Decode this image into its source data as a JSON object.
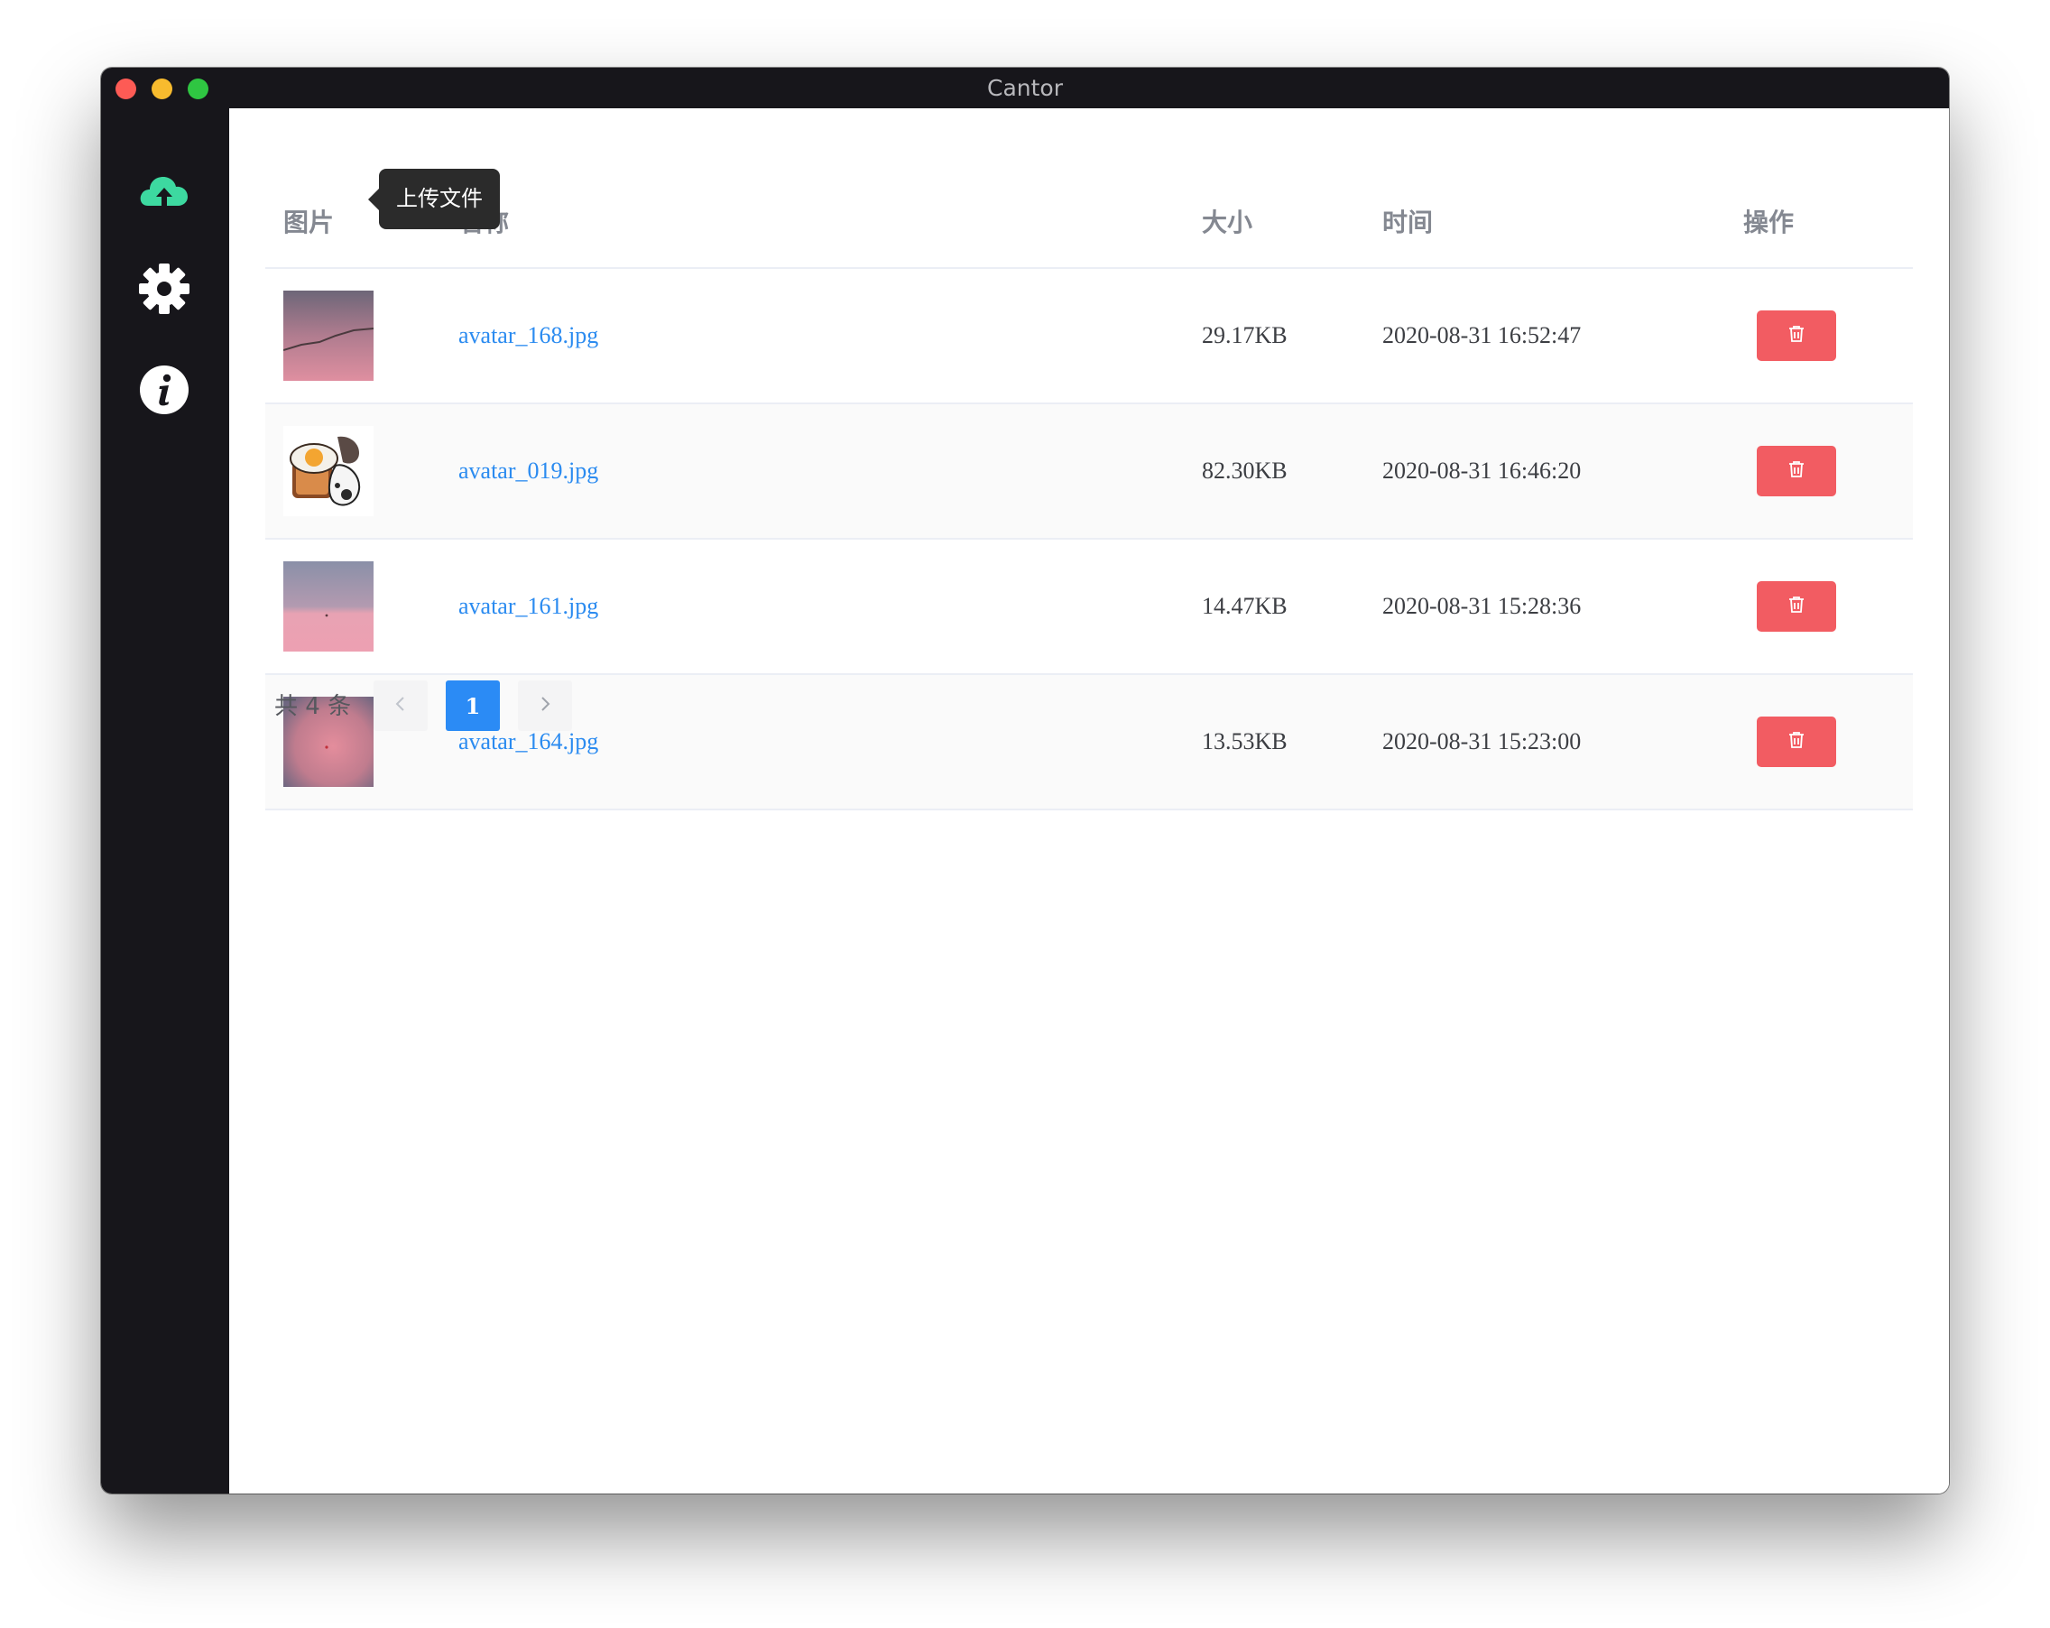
{
  "window": {
    "title": "Cantor"
  },
  "sidebar": {
    "items": [
      {
        "icon": "cloud-upload-icon",
        "active_color": "#3dd9a0"
      },
      {
        "icon": "gear-icon"
      },
      {
        "icon": "info-icon"
      }
    ]
  },
  "tooltip": {
    "text": "上传文件"
  },
  "table": {
    "headers": {
      "image": "图片",
      "name": "名称",
      "size": "大小",
      "time": "时间",
      "actions": "操作"
    },
    "rows": [
      {
        "name": "avatar_168.jpg",
        "size": "29.17KB",
        "time": "2020-08-31 16:52:47"
      },
      {
        "name": "avatar_019.jpg",
        "size": "82.30KB",
        "time": "2020-08-31 16:46:20"
      },
      {
        "name": "avatar_161.jpg",
        "size": "14.47KB",
        "time": "2020-08-31 15:28:36"
      },
      {
        "name": "avatar_164.jpg",
        "size": "13.53KB",
        "time": "2020-08-31 15:23:00"
      }
    ],
    "delete_icon": "trash-icon"
  },
  "pagination": {
    "total_text": "共 4 条",
    "current_page": "1"
  },
  "colors": {
    "link": "#2b8bf0",
    "danger": "#f25c62",
    "primary": "#2b8bf5",
    "sidebar_bg": "#17161b"
  }
}
